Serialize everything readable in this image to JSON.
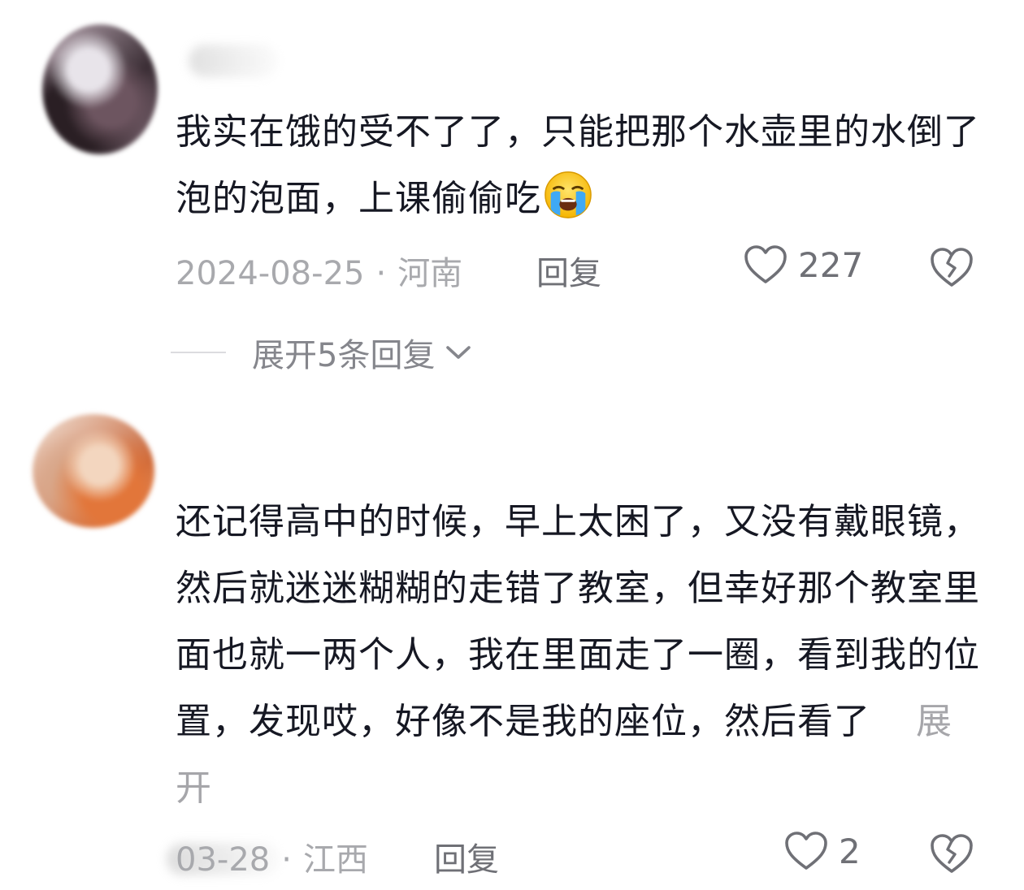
{
  "comments": [
    {
      "text": "我实在饿的受不了了，只能把那个水壶里的水倒了泡的泡面，上课偷偷吃",
      "emoji": "crying-face-icon",
      "date": "2024-08-25",
      "location": "河南",
      "reply_label": "回复",
      "likes": "227",
      "expand_replies_label": "展开5条回复"
    },
    {
      "text": "还记得高中的时候，早上太困了，又没有戴眼镜，然后就迷迷糊糊的走错了教室，但幸好那个教室里面也就一两个人，我在里面走了一圈，看到我的位置，发现哎，好像不是我的座位，然后看了",
      "expand_label": "展开",
      "date": "03-28",
      "location": "江西",
      "reply_label": "回复",
      "likes": "2"
    }
  ],
  "separator": "·",
  "colors": {
    "text": "#161823",
    "meta": "#a8a9ad",
    "action": "#6f7076",
    "expand": "#85868c"
  }
}
